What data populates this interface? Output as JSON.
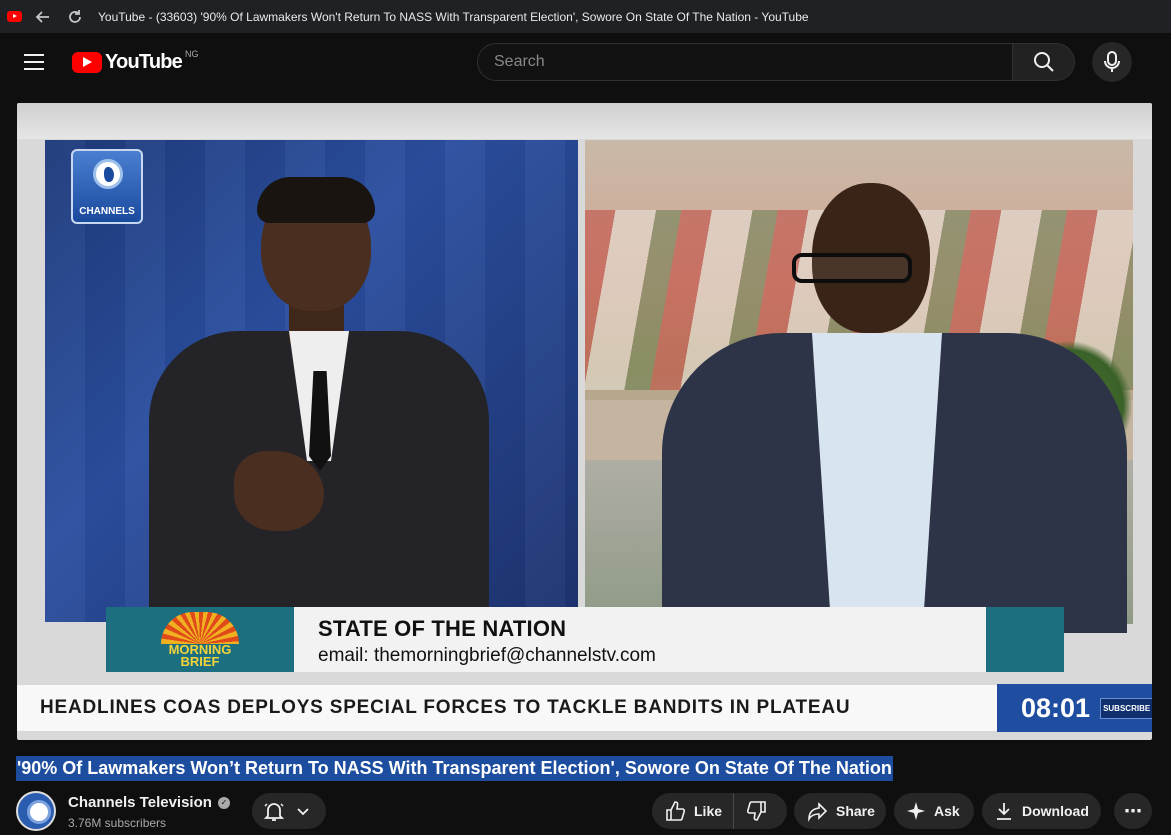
{
  "browser": {
    "tab_title": "YouTube - (33603) '90% Of Lawmakers Won't Return To NASS With Transparent Election', Sowore On State Of The Nation - YouTube",
    "back_icon": "back-arrow-icon",
    "reload_icon": "reload-icon"
  },
  "masthead": {
    "logo_text": "YouTube",
    "region": "NG",
    "search_placeholder": "Search",
    "search_value": ""
  },
  "video": {
    "broadcaster_logo": "CHANNELS",
    "show_logo_lines": [
      "MORNING",
      "BRIEF"
    ],
    "lower_third_title": "STATE OF THE NATION",
    "lower_third_email": "email: themorningbrief@channelstv.com",
    "ticker_text": "HEADLINES  COAS DEPLOYS SPECIAL FORCES TO TACKLE BANDITS IN PLATEAU",
    "clock": "08:01",
    "subscribe_badge": "SUBSCRIBE"
  },
  "title": "'90% Of Lawmakers Won’t Return To NASS With Transparent Election', Sowore On State Of The Nation",
  "channel": {
    "name": "Channels Television",
    "subscribers": "3.76M subscribers"
  },
  "actions": {
    "like": "Like",
    "share": "Share",
    "ask": "Ask",
    "download": "Download",
    "more": "⋯"
  },
  "colors": {
    "youtube_red": "#ff0000",
    "title_highlight": "#1c4d9e",
    "ticker_blue": "#1f4da0",
    "lower_third_teal": "#1c6f7e"
  }
}
